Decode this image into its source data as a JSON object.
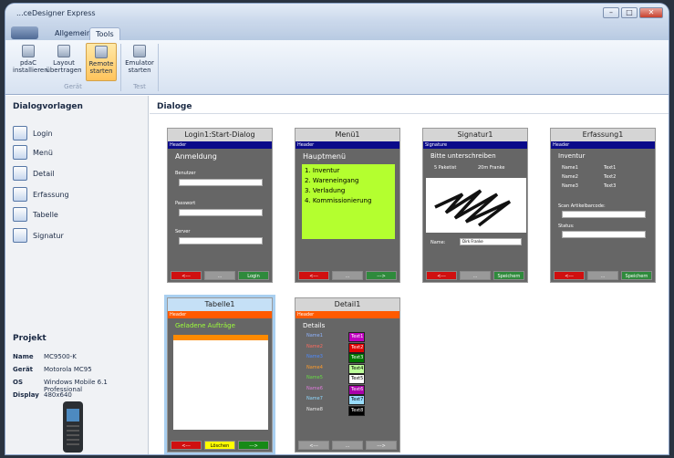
{
  "window": {
    "title": "...ceDesigner Express"
  },
  "tabs": {
    "allgemein": "Allgemein",
    "tools": "Tools"
  },
  "ribbon": {
    "install": "pdaC installieren",
    "layout": "Layout übertragen",
    "remote": "Remote starten",
    "emulator": "Emulator starten",
    "group_geraet": "Gerät",
    "group_test": "Test"
  },
  "sidebar": {
    "title": "Dialogvorlagen",
    "items": [
      "Login",
      "Menü",
      "Detail",
      "Erfassung",
      "Tabelle",
      "Signatur"
    ]
  },
  "project": {
    "title": "Projekt",
    "rows": [
      [
        "Name",
        "MC9500-K"
      ],
      [
        "Gerät",
        "Motorola MC95"
      ],
      [
        "OS",
        "Windows Mobile 6.1 Professional"
      ],
      [
        "Display",
        "480x640"
      ]
    ]
  },
  "main": {
    "title": "Dialoge"
  },
  "cards": {
    "login": {
      "title": "Login1:Start-Dialog",
      "header": "Header",
      "heading": "Anmeldung",
      "benutzer": "Benutzer",
      "passwort": "Passwort",
      "server": "Server",
      "back": "<---",
      "mid": "...",
      "ok": "Login"
    },
    "menu": {
      "title": "Menü1",
      "header": "Header",
      "heading": "Hauptmenü",
      "items": [
        "1. Inventur",
        "2. Wareneingang",
        "3. Verladung",
        "4. Kommissionierung"
      ],
      "back": "<---",
      "mid": "...",
      "next": "--->"
    },
    "sig": {
      "title": "Signatur1",
      "header": "Signature",
      "heading": "Bitte unterschreiben",
      "pak": "5 Paketist",
      "price": "20m Franke",
      "name_label": "Name:",
      "name_val": "Dirk Franke",
      "back": "<---",
      "mid": "...",
      "save": "Speichern"
    },
    "erf": {
      "title": "Erfassung1",
      "header": "Header",
      "heading": "Inventur",
      "rows": [
        [
          "Name1",
          "Text1"
        ],
        [
          "Name2",
          "Text2"
        ],
        [
          "Name3",
          "Text3"
        ]
      ],
      "scan": "Scan Artikelbarcode:",
      "status": "Status:",
      "back": "<---",
      "mid": "...",
      "save": "Speichern"
    },
    "tab": {
      "title": "Tabelle1",
      "header": "Header",
      "heading": "Geladene Aufträge",
      "back": "<---",
      "del": "Löschen",
      "next": "--->"
    },
    "det": {
      "title": "Detail1",
      "header": "Header",
      "heading": "Details",
      "rows": [
        [
          "Name1",
          "Text1"
        ],
        [
          "Name2",
          "Text2"
        ],
        [
          "Name3",
          "Text3"
        ],
        [
          "Name4",
          "Text4"
        ],
        [
          "Name5",
          "Text5"
        ],
        [
          "Name6",
          "Text6"
        ],
        [
          "Name7",
          "Text7"
        ],
        [
          "Name8",
          "Text8"
        ]
      ],
      "name_colors": [
        "#8fb4ff",
        "#ff6b5e",
        "#4d8bff",
        "#ff9b2a",
        "#66dd44",
        "#e07bdc",
        "#8fd9ff",
        "#e8e8e8"
      ],
      "text_bg": [
        "#c000c0",
        "#e00000",
        "#007700",
        "#bbff99",
        "#ffffff",
        "#aa00aa",
        "#99ddff",
        "#000000"
      ],
      "text_fg": [
        "#fff",
        "#fff",
        "#fff",
        "#000",
        "#000",
        "#fff",
        "#000",
        "#fff"
      ],
      "back": "<---",
      "mid": "...",
      "next": "--->"
    }
  }
}
